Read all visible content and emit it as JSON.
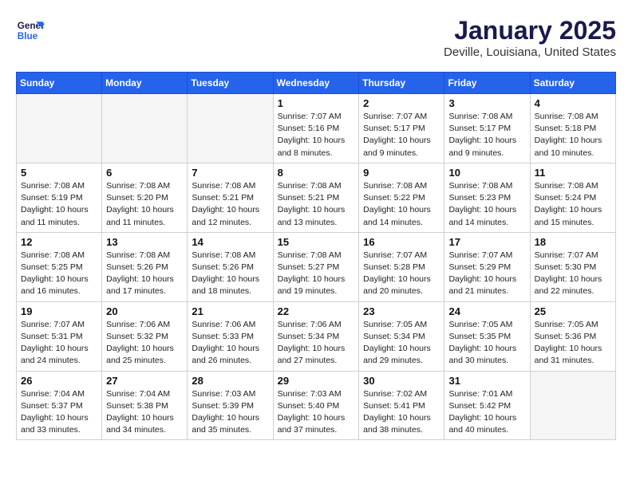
{
  "logo": {
    "line1": "General",
    "line2": "Blue"
  },
  "title": "January 2025",
  "subtitle": "Deville, Louisiana, United States",
  "days_of_week": [
    "Sunday",
    "Monday",
    "Tuesday",
    "Wednesday",
    "Thursday",
    "Friday",
    "Saturday"
  ],
  "weeks": [
    [
      {
        "day": "",
        "info": ""
      },
      {
        "day": "",
        "info": ""
      },
      {
        "day": "",
        "info": ""
      },
      {
        "day": "1",
        "info": "Sunrise: 7:07 AM\nSunset: 5:16 PM\nDaylight: 10 hours\nand 8 minutes."
      },
      {
        "day": "2",
        "info": "Sunrise: 7:07 AM\nSunset: 5:17 PM\nDaylight: 10 hours\nand 9 minutes."
      },
      {
        "day": "3",
        "info": "Sunrise: 7:08 AM\nSunset: 5:17 PM\nDaylight: 10 hours\nand 9 minutes."
      },
      {
        "day": "4",
        "info": "Sunrise: 7:08 AM\nSunset: 5:18 PM\nDaylight: 10 hours\nand 10 minutes."
      }
    ],
    [
      {
        "day": "5",
        "info": "Sunrise: 7:08 AM\nSunset: 5:19 PM\nDaylight: 10 hours\nand 11 minutes."
      },
      {
        "day": "6",
        "info": "Sunrise: 7:08 AM\nSunset: 5:20 PM\nDaylight: 10 hours\nand 11 minutes."
      },
      {
        "day": "7",
        "info": "Sunrise: 7:08 AM\nSunset: 5:21 PM\nDaylight: 10 hours\nand 12 minutes."
      },
      {
        "day": "8",
        "info": "Sunrise: 7:08 AM\nSunset: 5:21 PM\nDaylight: 10 hours\nand 13 minutes."
      },
      {
        "day": "9",
        "info": "Sunrise: 7:08 AM\nSunset: 5:22 PM\nDaylight: 10 hours\nand 14 minutes."
      },
      {
        "day": "10",
        "info": "Sunrise: 7:08 AM\nSunset: 5:23 PM\nDaylight: 10 hours\nand 14 minutes."
      },
      {
        "day": "11",
        "info": "Sunrise: 7:08 AM\nSunset: 5:24 PM\nDaylight: 10 hours\nand 15 minutes."
      }
    ],
    [
      {
        "day": "12",
        "info": "Sunrise: 7:08 AM\nSunset: 5:25 PM\nDaylight: 10 hours\nand 16 minutes."
      },
      {
        "day": "13",
        "info": "Sunrise: 7:08 AM\nSunset: 5:26 PM\nDaylight: 10 hours\nand 17 minutes."
      },
      {
        "day": "14",
        "info": "Sunrise: 7:08 AM\nSunset: 5:26 PM\nDaylight: 10 hours\nand 18 minutes."
      },
      {
        "day": "15",
        "info": "Sunrise: 7:08 AM\nSunset: 5:27 PM\nDaylight: 10 hours\nand 19 minutes."
      },
      {
        "day": "16",
        "info": "Sunrise: 7:07 AM\nSunset: 5:28 PM\nDaylight: 10 hours\nand 20 minutes."
      },
      {
        "day": "17",
        "info": "Sunrise: 7:07 AM\nSunset: 5:29 PM\nDaylight: 10 hours\nand 21 minutes."
      },
      {
        "day": "18",
        "info": "Sunrise: 7:07 AM\nSunset: 5:30 PM\nDaylight: 10 hours\nand 22 minutes."
      }
    ],
    [
      {
        "day": "19",
        "info": "Sunrise: 7:07 AM\nSunset: 5:31 PM\nDaylight: 10 hours\nand 24 minutes."
      },
      {
        "day": "20",
        "info": "Sunrise: 7:06 AM\nSunset: 5:32 PM\nDaylight: 10 hours\nand 25 minutes."
      },
      {
        "day": "21",
        "info": "Sunrise: 7:06 AM\nSunset: 5:33 PM\nDaylight: 10 hours\nand 26 minutes."
      },
      {
        "day": "22",
        "info": "Sunrise: 7:06 AM\nSunset: 5:34 PM\nDaylight: 10 hours\nand 27 minutes."
      },
      {
        "day": "23",
        "info": "Sunrise: 7:05 AM\nSunset: 5:34 PM\nDaylight: 10 hours\nand 29 minutes."
      },
      {
        "day": "24",
        "info": "Sunrise: 7:05 AM\nSunset: 5:35 PM\nDaylight: 10 hours\nand 30 minutes."
      },
      {
        "day": "25",
        "info": "Sunrise: 7:05 AM\nSunset: 5:36 PM\nDaylight: 10 hours\nand 31 minutes."
      }
    ],
    [
      {
        "day": "26",
        "info": "Sunrise: 7:04 AM\nSunset: 5:37 PM\nDaylight: 10 hours\nand 33 minutes."
      },
      {
        "day": "27",
        "info": "Sunrise: 7:04 AM\nSunset: 5:38 PM\nDaylight: 10 hours\nand 34 minutes."
      },
      {
        "day": "28",
        "info": "Sunrise: 7:03 AM\nSunset: 5:39 PM\nDaylight: 10 hours\nand 35 minutes."
      },
      {
        "day": "29",
        "info": "Sunrise: 7:03 AM\nSunset: 5:40 PM\nDaylight: 10 hours\nand 37 minutes."
      },
      {
        "day": "30",
        "info": "Sunrise: 7:02 AM\nSunset: 5:41 PM\nDaylight: 10 hours\nand 38 minutes."
      },
      {
        "day": "31",
        "info": "Sunrise: 7:01 AM\nSunset: 5:42 PM\nDaylight: 10 hours\nand 40 minutes."
      },
      {
        "day": "",
        "info": ""
      }
    ]
  ]
}
